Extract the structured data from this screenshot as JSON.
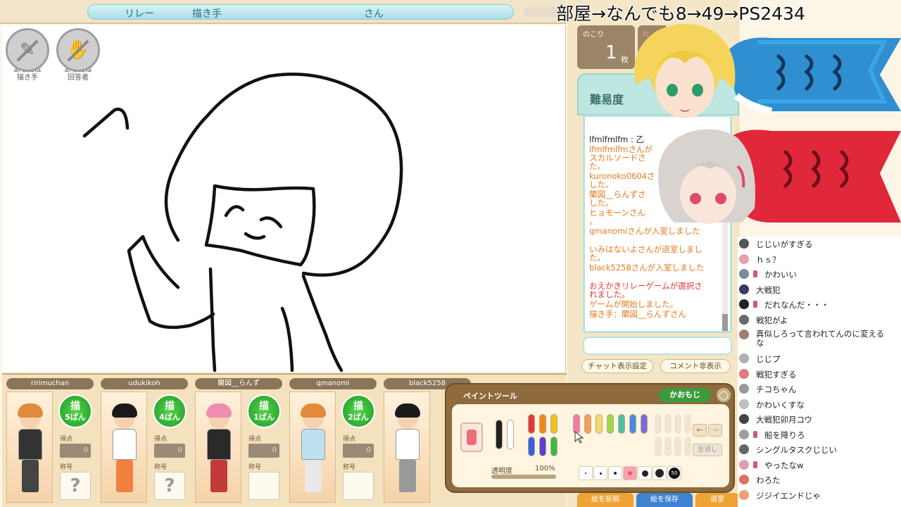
{
  "header": {
    "mode": "リレー",
    "role_label": "描き手",
    "suffix": "さん"
  },
  "role_badges": {
    "drawer": "あなたは\n描き手",
    "answerer": "あなたは\n回答者"
  },
  "players": [
    {
      "name": "ririmuchan",
      "draw_char": "描",
      "draw_rank": "5ばん",
      "score_label": "得点",
      "score": "0",
      "title_label": "称号",
      "title": "?",
      "hair": "#e08a3a",
      "outfit": "#333333",
      "legs": "#444444"
    },
    {
      "name": "udukikoh",
      "draw_char": "描",
      "draw_rank": "4ばん",
      "score_label": "得点",
      "score": "0",
      "title_label": "称号",
      "title": "?",
      "hair": "#1a1a1a",
      "outfit": "#ffffff",
      "legs": "#f08040"
    },
    {
      "name": "蘭図__らんず",
      "draw_char": "描",
      "draw_rank": "1ばん",
      "score_label": "得点",
      "score": "0",
      "title_label": "称号",
      "title": "",
      "hair": "#f08cb0",
      "outfit": "#2a2a2a",
      "legs": "#c23a3a"
    },
    {
      "name": "qmanomi",
      "draw_char": "描",
      "draw_rank": "2ばん",
      "score_label": "得点",
      "score": "0",
      "title_label": "称号",
      "title": "",
      "hair": "#e08a3a",
      "outfit": "#bfe1ef",
      "legs": "#e8e8e8"
    },
    {
      "name": "black5258",
      "draw_char": "",
      "draw_rank": "",
      "score_label": "",
      "score": "",
      "title_label": "",
      "title": "",
      "hair": "#1a1a1a",
      "outfit": "#ffffff",
      "legs": "#999999"
    }
  ],
  "info": {
    "remaining_label": "のこり",
    "remaining_count": "1",
    "remaining_unit": "枚",
    "second_label": "の",
    "difficulty_label": "難易度"
  },
  "chat": {
    "messages": [
      {
        "text": "lfmlfmlfm : 乙",
        "color": "black"
      },
      {
        "text": "lfmlfmlfmさんが\nスカルソードさ\nた。",
        "color": "orange"
      },
      {
        "text": "kuronoko0604さ\nした。",
        "color": "orange"
      },
      {
        "text": "蘭図__らんずさ\nした。",
        "color": "orange"
      },
      {
        "text": "ヒョモーンさん\n。",
        "color": "orange"
      },
      {
        "text": "qmanomiさんが入室しました",
        "color": "orange"
      },
      {
        "text": "\nいみはないよさんが退室しまし\nた。",
        "color": "orange"
      },
      {
        "text": "black5258さんが入室しました",
        "color": "orange"
      },
      {
        "text": "\nおえかきリレーゲームが選択さ\nれました。",
        "color": "red"
      },
      {
        "text": "ゲームが開始しました。",
        "color": "orange"
      },
      {
        "text": "描き手：蘭図__らんずさん",
        "color": "orange"
      }
    ],
    "settings_button": "チャット表示設定",
    "hide_comments_button": "コメント非表示"
  },
  "bottom_buttons": {
    "post": "絵を投稿",
    "save": "絵を保存",
    "exit": "退室"
  },
  "paint_tool": {
    "title": "ペイントツール",
    "kaomoji_button": "かおもじ",
    "close": "◯",
    "opacity_label": "透明度",
    "opacity_value": "100%",
    "opacity_fraction": 1.0,
    "undo": "←",
    "redo": "→",
    "clear_button": "全消し",
    "largest_size_label": "50",
    "pen_colors": [
      "#222222",
      "#ffffff",
      "#e23a3a",
      "#f08a1a",
      "#f2c21a",
      "#3b5fe0",
      "#5a3fd0",
      "#3cb84a",
      "#f47aa8",
      "#f4a05a",
      "#f4d86a",
      "#a0d84a",
      "#4ac0a0",
      "#4a8ae0",
      "#7a6ad8"
    ]
  },
  "overlay": {
    "title": "部屋→なんでも8→49→PS2434"
  },
  "viewer_comments": [
    {
      "text": "じじいがすぎる",
      "flag": false
    },
    {
      "text": "ｈｓ？",
      "flag": false
    },
    {
      "text": "かわいい",
      "flag": true
    },
    {
      "text": "大戦犯",
      "flag": false
    },
    {
      "text": "だれなんだ・・・",
      "flag": true
    },
    {
      "text": "戦犯がよ",
      "flag": false
    },
    {
      "text": "真似しろって言われてんのに変える\nな",
      "flag": false,
      "wrap": true
    },
    {
      "text": "じじプ",
      "flag": false
    },
    {
      "text": "戦犯すぎる",
      "flag": false
    },
    {
      "text": "チコちゃん",
      "flag": false
    },
    {
      "text": "かわいくすな",
      "flag": false
    },
    {
      "text": "大戦犯卯月コウ",
      "flag": false
    },
    {
      "text": "船を降りろ",
      "flag": true
    },
    {
      "text": "シングルタスクじじい",
      "flag": false
    },
    {
      "text": "やったなw",
      "flag": true
    },
    {
      "text": "わろた",
      "flag": false
    },
    {
      "text": "ジジイエンドじゃ",
      "flag": false
    }
  ]
}
